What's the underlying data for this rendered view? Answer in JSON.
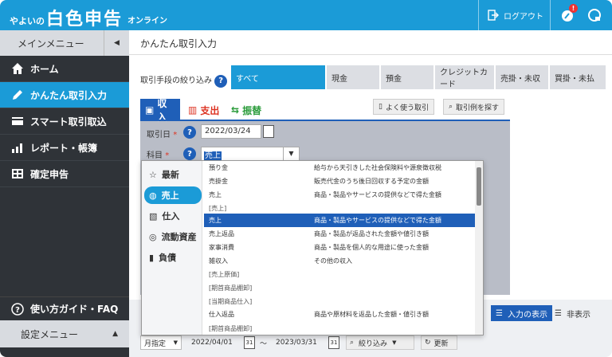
{
  "header": {
    "logo_small": "やよいの",
    "logo_big": "白色申告",
    "logo_kana": "オンライン",
    "logout_label": "ログアウト",
    "notification_badge": "!"
  },
  "sidebar": {
    "menu_title": "メインメニュー",
    "items": [
      {
        "label": "ホーム",
        "icon": "home-icon"
      },
      {
        "label": "かんたん取引入力",
        "icon": "pencil-icon"
      },
      {
        "label": "スマート取引取込",
        "icon": "card-icon"
      },
      {
        "label": "レポート・帳簿",
        "icon": "chart-icon"
      },
      {
        "label": "確定申告",
        "icon": "calculator-icon"
      }
    ],
    "guide_label": "使い方ガイド・FAQ",
    "settings_label": "設定メニュー"
  },
  "main": {
    "title": "かんたん取引入力",
    "filter_label": "取引手段の絞り込み",
    "filters": [
      "すべて",
      "現金",
      "預金",
      "クレジットカード",
      "売掛・未収",
      "買掛・未払"
    ],
    "tabs": {
      "income": "収入",
      "expense": "支出",
      "transfer": "振替"
    },
    "easy_btn": "よく使う取引",
    "example_btn": "取引例を探す",
    "date_label": "取引日",
    "date_value": "2022/03/24",
    "account_label": "科目",
    "account_value": "売上",
    "required_mark": "*"
  },
  "popup": {
    "categories": [
      {
        "label": "最新",
        "icon": "star-icon"
      },
      {
        "label": "売上",
        "icon": "money-bag-icon"
      },
      {
        "label": "仕入",
        "icon": "box-icon"
      },
      {
        "label": "流動資産",
        "icon": "coins-icon"
      },
      {
        "label": "負債",
        "icon": "jar-icon"
      }
    ],
    "rows": [
      {
        "name": "預り金",
        "desc": "給与から天引きした社会保険料や源泉徴収税"
      },
      {
        "name": "売掛金",
        "desc": "販売代金のうち後日回収する予定の金額"
      },
      {
        "name": "売上",
        "desc": "商品・製品やサービスの提供などで得た金額"
      },
      {
        "name": "[売上]",
        "desc": ""
      },
      {
        "name": "売上",
        "desc": "商品・製品やサービスの提供などで得た金額"
      },
      {
        "name": "売上返品",
        "desc": "商品・製品が返品された金額や値引き額"
      },
      {
        "name": "家事消費",
        "desc": "商品・製品を個人的な用途に使った金額"
      },
      {
        "name": "雑収入",
        "desc": "その他の収入"
      },
      {
        "name": "[売上原価]",
        "desc": ""
      },
      {
        "name": "[期首商品棚卸]",
        "desc": ""
      },
      {
        "name": "[当期商品仕入]",
        "desc": ""
      },
      {
        "name": "仕入返品",
        "desc": "商品や原材料を返品した金額・値引き額"
      },
      {
        "name": "[期首商品棚卸]",
        "desc": ""
      }
    ]
  },
  "bottom": {
    "show_input": "入力の表示",
    "hide": "非表示",
    "month_select": "月指定",
    "from_date": "2022/04/01",
    "tilde": "～",
    "to_date": "2023/03/31",
    "filter_btn": "絞り込み",
    "refresh_btn": "更新",
    "cal_num": "31"
  },
  "colors": {
    "brand": "#1b9bd7",
    "dark_blue": "#1f5fb8",
    "sidebar": "#2f3338"
  }
}
